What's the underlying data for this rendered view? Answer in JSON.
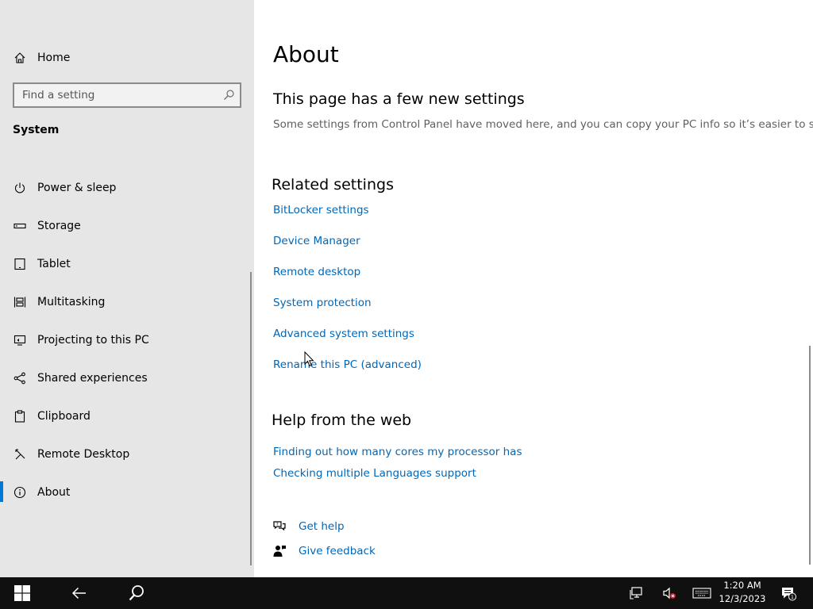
{
  "sidebar": {
    "home_label": "Home",
    "search_placeholder": "Find a setting",
    "section_title": "System",
    "items": [
      {
        "label": "Power & sleep",
        "icon": "power-icon"
      },
      {
        "label": "Storage",
        "icon": "storage-icon"
      },
      {
        "label": "Tablet",
        "icon": "tablet-icon"
      },
      {
        "label": "Multitasking",
        "icon": "multitasking-icon"
      },
      {
        "label": "Projecting to this PC",
        "icon": "projecting-icon"
      },
      {
        "label": "Shared experiences",
        "icon": "shared-experiences-icon"
      },
      {
        "label": "Clipboard",
        "icon": "clipboard-icon"
      },
      {
        "label": "Remote Desktop",
        "icon": "remote-desktop-icon"
      },
      {
        "label": "About",
        "icon": "info-icon",
        "selected": true
      }
    ]
  },
  "main": {
    "title": "About",
    "new_settings_heading": "This page has a few new settings",
    "new_settings_desc": "Some settings from Control Panel have moved here, and you can copy your PC info so it’s easier to share.",
    "related_heading": "Related settings",
    "related_links": [
      "BitLocker settings",
      "Device Manager",
      "Remote desktop",
      "System protection",
      "Advanced system settings",
      "Rename this PC (advanced)"
    ],
    "help_heading": "Help from the web",
    "help_links": [
      "Finding out how many cores my processor has",
      "Checking multiple Languages support"
    ],
    "get_help": "Get help",
    "give_feedback": "Give feedback"
  },
  "taskbar": {
    "time": "1:20 AM",
    "date": "12/3/2023",
    "notification_count": "1"
  },
  "colors": {
    "accent": "#0078d7",
    "link": "#0067b8",
    "sidebar_bg": "#e6e6e6",
    "taskbar_bg": "#101010"
  }
}
